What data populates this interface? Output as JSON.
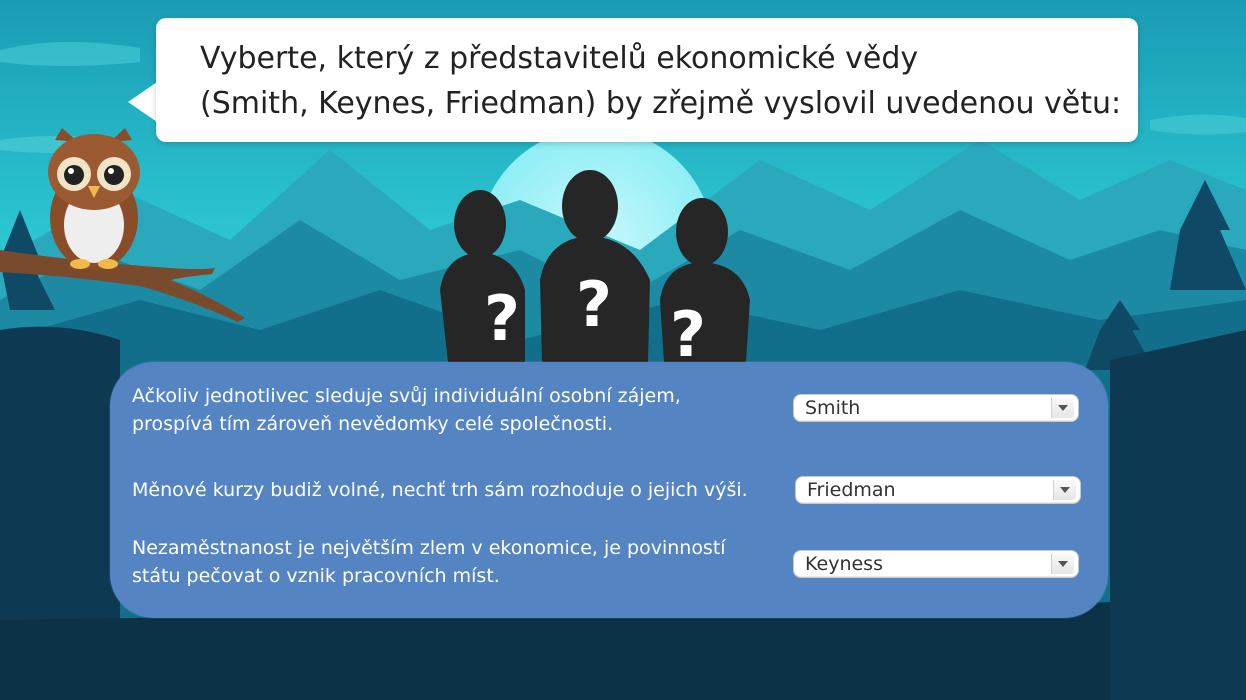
{
  "question": {
    "line1": "Vyberte, který z představitelů ekonomické vědy",
    "line2": "(Smith, Keynes, Friedman) by zřejmě vyslovil uvedenou větu:"
  },
  "items": [
    {
      "lines": [
        "Ačkoliv jednotlivec sleduje svůj individuální osobní zájem,",
        "prospívá tím zároveň nevědomky celé společnosti."
      ],
      "selected": "Smith"
    },
    {
      "lines": [
        "Měnové kurzy budiž volné, nechť trh sám rozhoduje o jejich výši."
      ],
      "selected": "Friedman"
    },
    {
      "lines": [
        "Nezaměstnanost je největším zlem v ekonomice, je povinností",
        "státu pečovat o vznik pracovních míst."
      ],
      "selected": "Keyness"
    }
  ],
  "colors": {
    "sky": "#1fb9c6",
    "panel": "#5485c2",
    "forest_dark": "#0d3a52"
  },
  "icons": {
    "owl": "owl-icon",
    "silhouettes": "mystery-people-icon",
    "dropdown": "chevron-down-icon"
  }
}
